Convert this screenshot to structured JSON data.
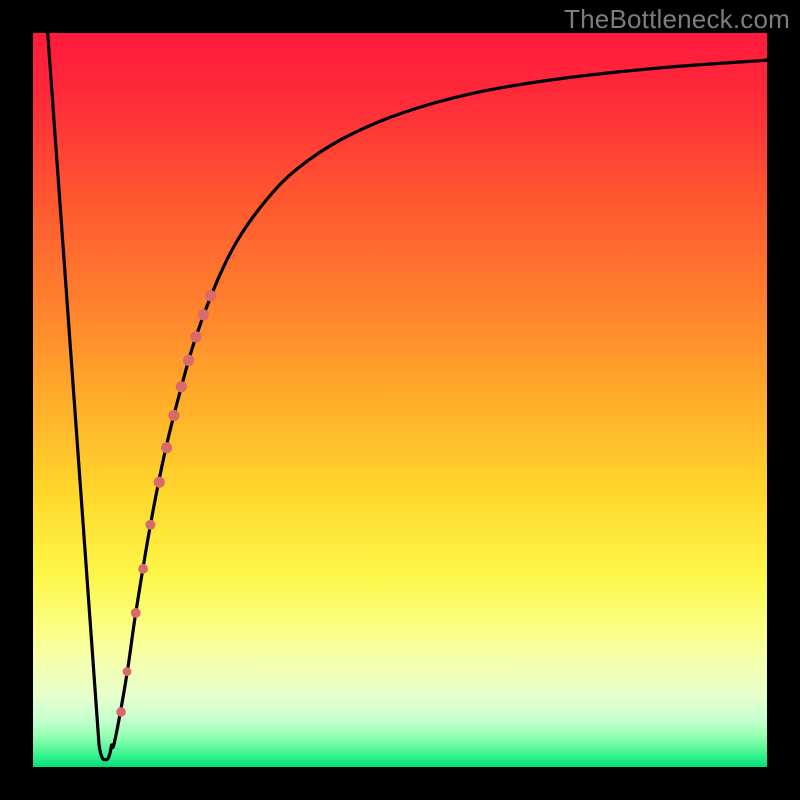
{
  "attribution": "TheBottleneck.com",
  "chart_data": {
    "type": "line",
    "title": "",
    "xlabel": "",
    "ylabel": "",
    "xlim": [
      0,
      100
    ],
    "ylim": [
      0,
      100
    ],
    "curve": {
      "x": [
        2,
        4.5,
        7,
        8.5,
        9.5,
        10,
        10.5,
        11,
        12,
        13,
        14,
        16,
        18,
        20,
        22,
        25,
        28,
        32,
        36,
        42,
        50,
        60,
        72,
        86,
        100
      ],
      "y": [
        100,
        55,
        14,
        3,
        1,
        1,
        1,
        3,
        8,
        14,
        21,
        33,
        43,
        51,
        58,
        66,
        72,
        77.5,
        81.5,
        85.5,
        89,
        91.8,
        93.8,
        95.3,
        96.3
      ]
    },
    "flat_bottom": {
      "x_start": 9.0,
      "x_end": 10.7,
      "y": 1
    },
    "markers": [
      {
        "x": 17.2,
        "y": 38.8,
        "r": 5.6
      },
      {
        "x": 18.2,
        "y": 43.5,
        "r": 5.6
      },
      {
        "x": 19.2,
        "y": 47.9,
        "r": 5.6
      },
      {
        "x": 20.2,
        "y": 51.8,
        "r": 5.6
      },
      {
        "x": 21.2,
        "y": 55.4,
        "r": 5.6
      },
      {
        "x": 22.2,
        "y": 58.6,
        "r": 5.6
      },
      {
        "x": 23.2,
        "y": 61.6,
        "r": 5.6
      },
      {
        "x": 24.2,
        "y": 64.2,
        "r": 5.6
      },
      {
        "x": 16.0,
        "y": 33.0,
        "r": 5.0
      },
      {
        "x": 15.0,
        "y": 27.0,
        "r": 4.9
      },
      {
        "x": 14.0,
        "y": 21.0,
        "r": 4.9
      },
      {
        "x": 12.8,
        "y": 13.0,
        "r": 4.4
      },
      {
        "x": 12.0,
        "y": 7.5,
        "r": 4.8
      }
    ],
    "gradient_stops": [
      {
        "offset": 0,
        "color": "#ff1a3c"
      },
      {
        "offset": 0.09,
        "color": "#ff2b3a"
      },
      {
        "offset": 0.22,
        "color": "#ff5530"
      },
      {
        "offset": 0.36,
        "color": "#ff7e2e"
      },
      {
        "offset": 0.5,
        "color": "#ffad2a"
      },
      {
        "offset": 0.63,
        "color": "#ffd82c"
      },
      {
        "offset": 0.74,
        "color": "#fdf74a"
      },
      {
        "offset": 0.81,
        "color": "#fbff84"
      },
      {
        "offset": 0.86,
        "color": "#f4ffb0"
      },
      {
        "offset": 0.905,
        "color": "#e6ffce"
      },
      {
        "offset": 0.935,
        "color": "#c7ffce"
      },
      {
        "offset": 0.96,
        "color": "#8effb0"
      },
      {
        "offset": 0.985,
        "color": "#35f18e"
      },
      {
        "offset": 1.0,
        "color": "#00e173"
      }
    ]
  }
}
